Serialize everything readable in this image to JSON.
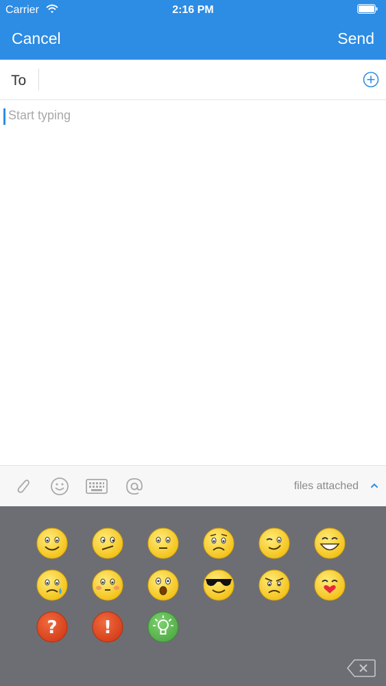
{
  "status": {
    "carrier": "Carrier",
    "time": "2:16 PM"
  },
  "nav": {
    "cancel_label": "Cancel",
    "send_label": "Send"
  },
  "compose": {
    "to_label": "To",
    "to_value": "",
    "body_placeholder": "Start typing",
    "body_value": ""
  },
  "toolbar": {
    "icons": [
      "paperclip-icon",
      "smiley-icon",
      "keyboard-icon",
      "at-icon"
    ],
    "files_label": "files attached"
  },
  "emoji_panel": {
    "emojis": [
      "smile",
      "confused",
      "neutral",
      "worried",
      "wink",
      "grin",
      "cry",
      "blush",
      "surprised",
      "cool",
      "angry",
      "kiss",
      "question",
      "exclamation",
      "idea"
    ]
  },
  "colors": {
    "accent": "#2D8CE3",
    "emoji_panel_bg": "#6D6E73",
    "face": "#F8C81C"
  }
}
